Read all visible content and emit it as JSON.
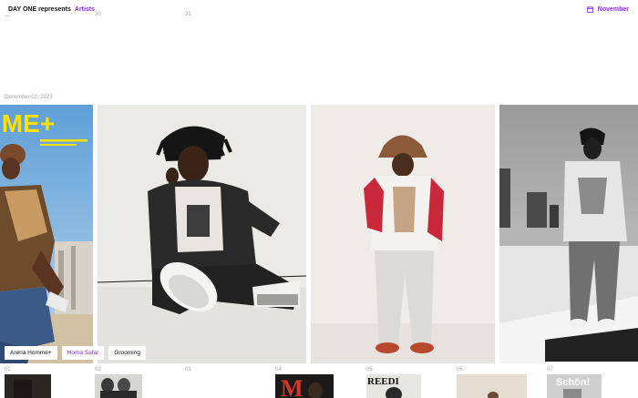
{
  "header": {
    "brand_name": "DAY ONE represents",
    "brand_section": "Artists",
    "month": "November"
  },
  "top_days": [
    "30",
    "31"
  ],
  "date_heading": "December 02, 2023",
  "cover": {
    "masthead": "IME+"
  },
  "tags": [
    "Arena Homme+",
    "Homa Safar",
    "Grooming"
  ],
  "bottom_days": [
    "01",
    "02",
    "03",
    "04",
    "05",
    "06",
    "07"
  ],
  "thumbs": {
    "magazine_letter": "M",
    "magazine_reed": "REEDI",
    "magazine_schon": "Schön!"
  },
  "colors": {
    "accent": "#8a2be2"
  }
}
